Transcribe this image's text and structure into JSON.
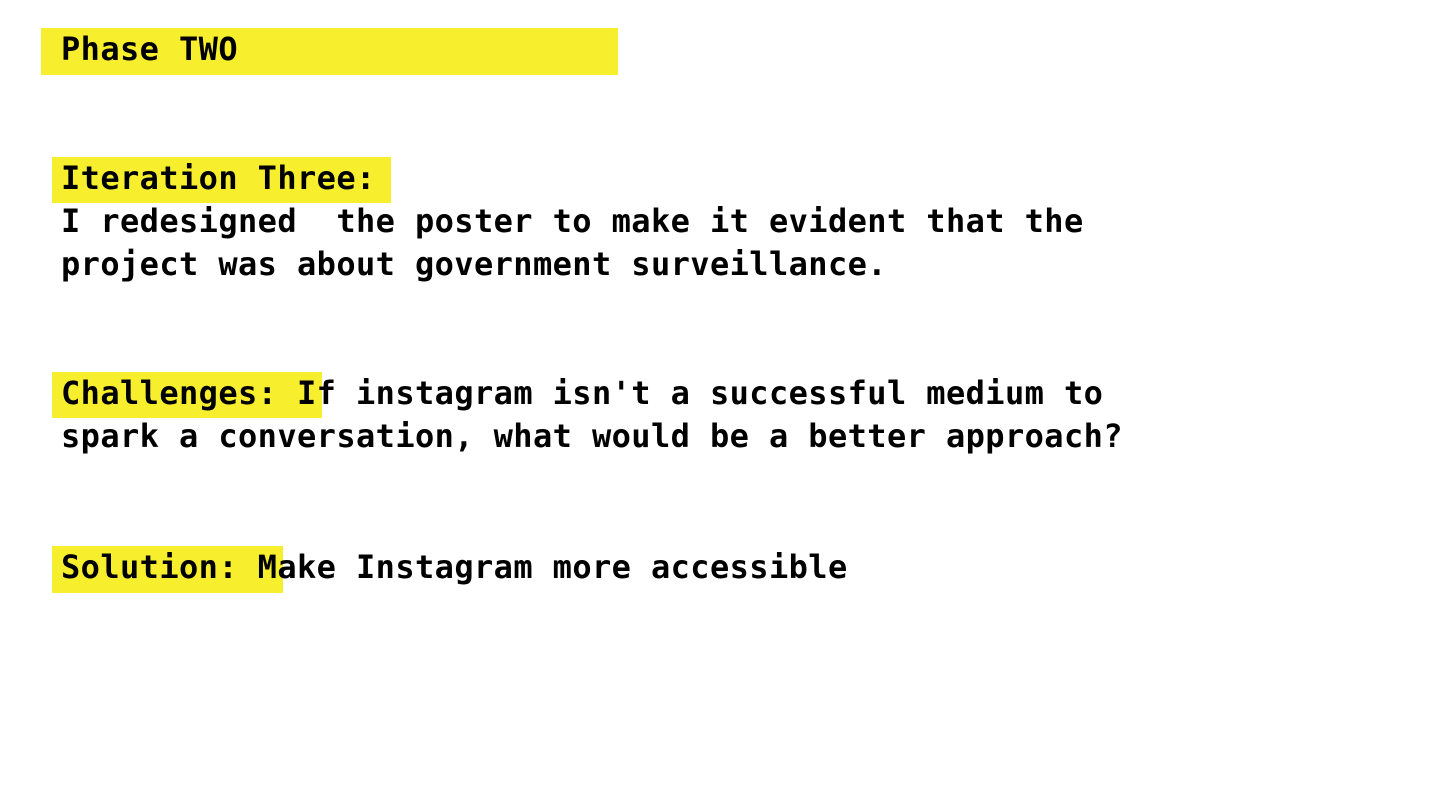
{
  "colors": {
    "highlight": "#f7ef2e",
    "background": "#ffffff",
    "text": "#000000"
  },
  "phase": {
    "title": "Phase TWO"
  },
  "iteration": {
    "heading": "Iteration Three:",
    "body_line1": "I redesigned  the poster to make it evident that the",
    "body_line2": "project was about government surveillance."
  },
  "challenges": {
    "label": "Challenges:",
    "line1": " If instagram isn't a successful medium to",
    "line2": "spark a conversation, what would be a better approach?"
  },
  "solution": {
    "label": "Solution:",
    "text": " Make Instagram more accessible"
  }
}
